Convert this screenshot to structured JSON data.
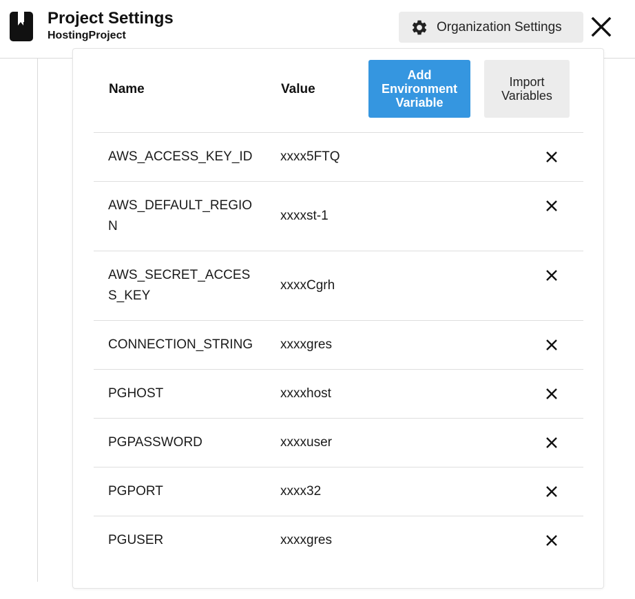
{
  "header": {
    "title": "Project Settings",
    "subtitle": "HostingProject",
    "org_button_label": "Organization Settings",
    "org_button_icon": "gear-icon",
    "close_icon": "close-icon"
  },
  "table": {
    "columns": {
      "name": "Name",
      "value": "Value"
    },
    "add_button_label": "Add Environment Variable",
    "import_button_label": "Import Variables",
    "rows": [
      {
        "name": "AWS_ACCESS_KEY_ID",
        "value": "xxxx5FTQ"
      },
      {
        "name": "AWS_DEFAULT_REGION",
        "value": "xxxxst-1"
      },
      {
        "name": "AWS_SECRET_ACCESS_KEY",
        "value": "xxxxCgrh"
      },
      {
        "name": "CONNECTION_STRING",
        "value": "xxxxgres"
      },
      {
        "name": "PGHOST",
        "value": "xxxxhost"
      },
      {
        "name": "PGPASSWORD",
        "value": "xxxxuser"
      },
      {
        "name": "PGPORT",
        "value": "xxxx32"
      },
      {
        "name": "PGUSER",
        "value": "xxxxgres"
      }
    ]
  },
  "colors": {
    "accent": "#3596e0",
    "secondary_button": "#ececec",
    "divider": "#dedede"
  }
}
